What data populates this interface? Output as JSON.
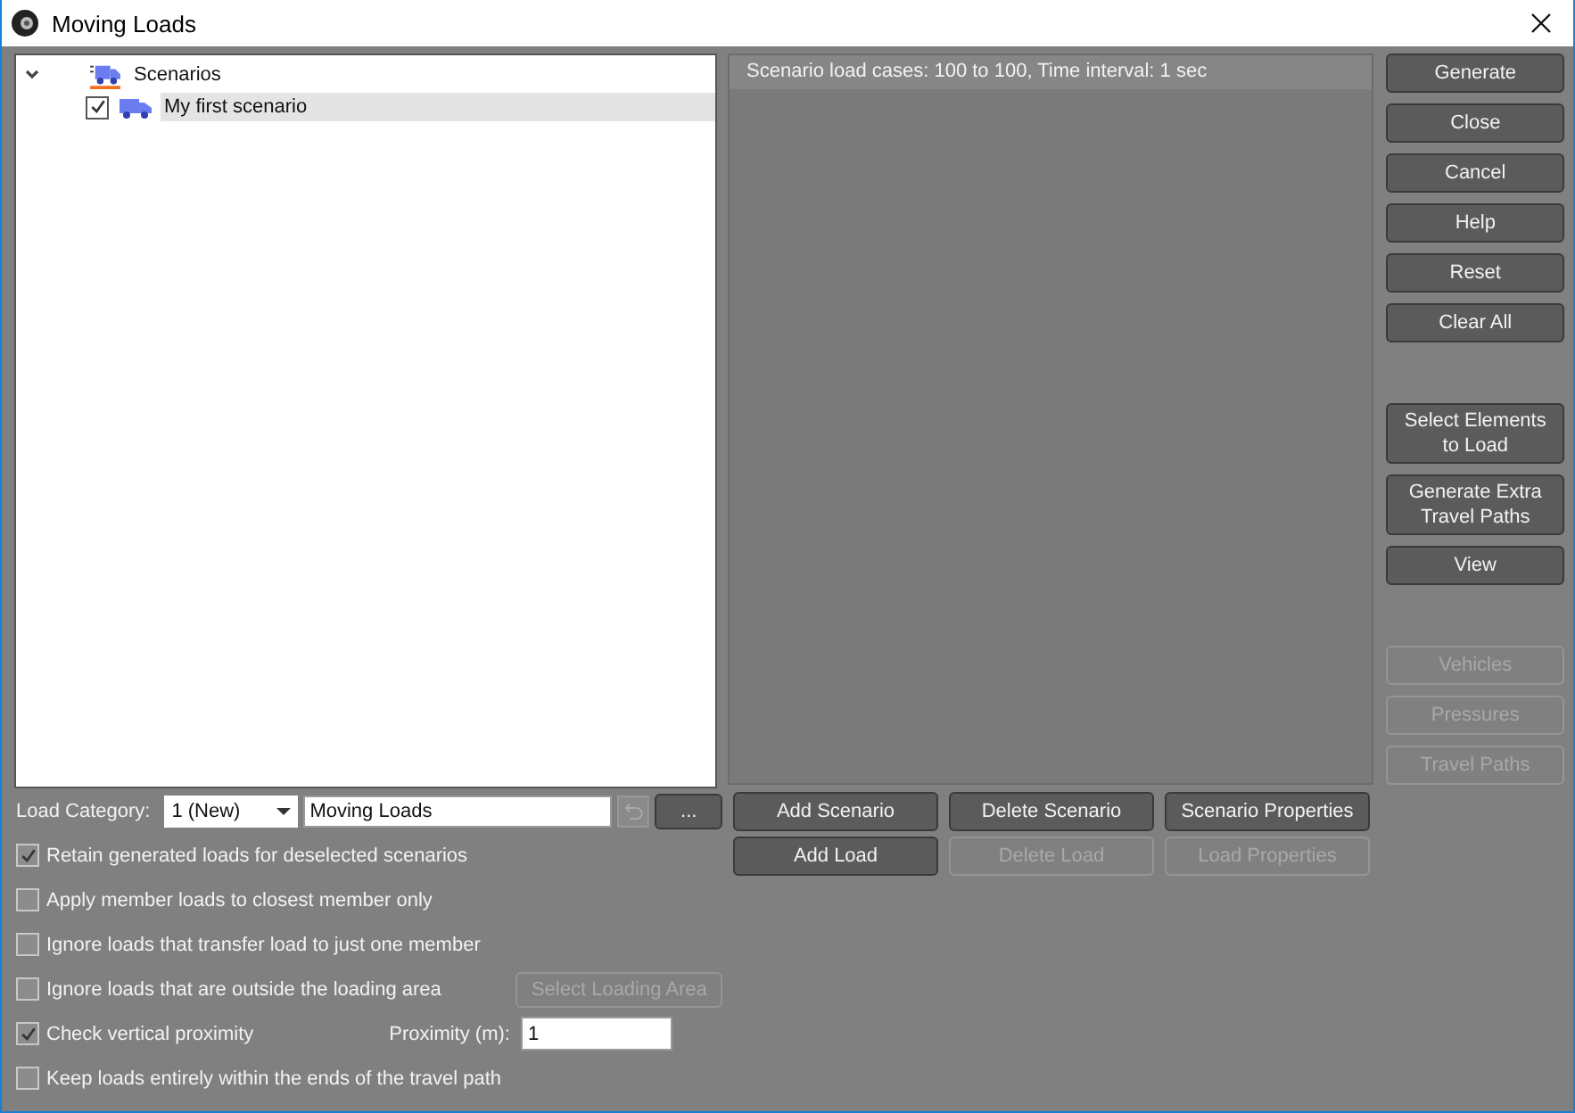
{
  "window": {
    "title": "Moving Loads"
  },
  "tree": {
    "label": "Scenarios",
    "expanded": true,
    "children": [
      {
        "label": "My first scenario",
        "checked": true,
        "selected": true
      }
    ]
  },
  "panel": {
    "summary": "Scenario load cases: 100 to 100, Time interval: 1 sec"
  },
  "side_buttons": [
    [
      {
        "label": "Generate",
        "disabled": false
      },
      {
        "label": "Close",
        "disabled": false
      },
      {
        "label": "Cancel",
        "disabled": false
      },
      {
        "label": "Help",
        "disabled": false
      },
      {
        "label": "Reset",
        "disabled": false
      },
      {
        "label": "Clear All",
        "disabled": false
      }
    ],
    [
      {
        "label": "Select Elements to Load",
        "disabled": false
      },
      {
        "label": "Generate Extra Travel Paths",
        "disabled": false
      },
      {
        "label": "View",
        "disabled": false
      }
    ],
    [
      {
        "label": "Vehicles",
        "disabled": true
      },
      {
        "label": "Pressures",
        "disabled": true
      },
      {
        "label": "Travel Paths",
        "disabled": true
      }
    ]
  ],
  "load_category": {
    "label": "Load Category:",
    "value": "1 (New)",
    "name": "Moving Loads",
    "more_button": "..."
  },
  "scenario_buttons": [
    {
      "label": "Add Scenario",
      "disabled": false
    },
    {
      "label": "Delete Scenario",
      "disabled": false
    },
    {
      "label": "Scenario Properties",
      "disabled": false
    },
    {
      "label": "Add Load",
      "disabled": false
    },
    {
      "label": "Delete Load",
      "disabled": true
    },
    {
      "label": "Load Properties",
      "disabled": true
    }
  ],
  "options": [
    {
      "label": "Retain generated loads for deselected scenarios",
      "checked": true
    },
    {
      "label": "Apply member loads to closest member only",
      "checked": false
    },
    {
      "label": "Ignore loads that transfer load to just one member",
      "checked": false
    },
    {
      "label": "Ignore loads that are outside the loading area",
      "checked": false,
      "button": {
        "label": "Select Loading Area",
        "disabled": true
      }
    },
    {
      "label": "Check vertical proximity",
      "checked": true,
      "field": {
        "label": "Proximity (m):",
        "value": "1"
      }
    },
    {
      "label": "Keep loads entirely within the ends of the travel path",
      "checked": false
    }
  ]
}
